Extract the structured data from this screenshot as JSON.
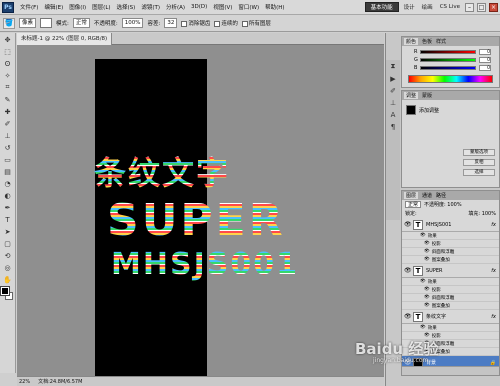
{
  "app": {
    "logo": "Ps",
    "zoom": "22%",
    "workspace": "基本功能",
    "workspace_links": [
      "设计",
      "绘画"
    ],
    "cs_live": "CS Live"
  },
  "menu": [
    "文件(F)",
    "编辑(E)",
    "图像(I)",
    "图层(L)",
    "选择(S)",
    "滤镜(T)",
    "分析(A)",
    "3D(D)",
    "视图(V)",
    "窗口(W)",
    "帮助(H)"
  ],
  "options": {
    "size": "像素",
    "mode_label": "模式:",
    "mode_value": "正常",
    "opacity_label": "不透明度:",
    "opacity_value": "100%",
    "tolerance_label": "容差:",
    "tolerance_value": "32",
    "antialias": "消除锯齿",
    "contiguous": "连续的",
    "all_layers": "所有图层"
  },
  "document": {
    "tab": "未标题-1 @ 22% (图层 0, RGB/8)",
    "status_zoom": "22%",
    "status_doc": "文档:24.8M/6.57M",
    "art_line1": "条纹文字",
    "art_line2": "SUPER",
    "art_line3": "MHSJS001"
  },
  "panels": {
    "color_tabs": [
      "颜色",
      "色板",
      "样式"
    ],
    "sliders": [
      {
        "label": "R",
        "value": "0"
      },
      {
        "label": "G",
        "value": "0"
      },
      {
        "label": "B",
        "value": "0"
      }
    ],
    "adjust_tabs": [
      "调整",
      "蒙版"
    ],
    "adjust_item": "添加调整",
    "adjust_btn1": "蒙版选项",
    "adjust_btn2": "反相",
    "adjust_btn3": "选择",
    "layers_tabs": [
      "图层",
      "通道",
      "路径"
    ],
    "blend_mode": "正常",
    "opacity": "不透明度: 100%",
    "lock": "锁定:",
    "fill": "填充: 100%",
    "layers": [
      {
        "name": "MHSJS001",
        "fx": "fx",
        "effects": [
          "效果",
          "投影",
          "斜面和浮雕",
          "图案叠加"
        ]
      },
      {
        "name": "SUPER",
        "fx": "fx",
        "effects": [
          "效果",
          "投影",
          "斜面和浮雕",
          "图案叠加"
        ]
      },
      {
        "name": "条纹文字",
        "fx": "fx",
        "effects": [
          "效果",
          "投影",
          "斜面和浮雕",
          "图案叠加"
        ]
      }
    ],
    "background_layer": "背景"
  },
  "watermark": {
    "text": "Baidu 经验",
    "sub": "jingyan.baidu.com"
  }
}
